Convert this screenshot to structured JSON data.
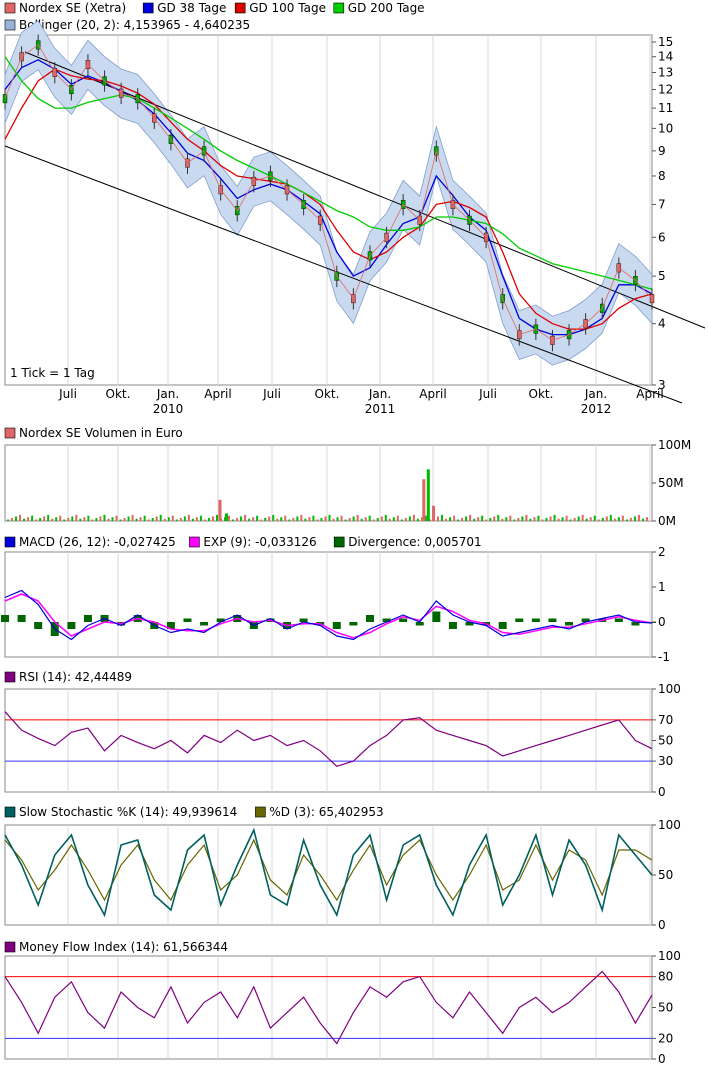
{
  "chart_data": [
    {
      "type": "line",
      "title": "",
      "legend": [
        {
          "label": "Nordex SE (Xetra)",
          "color": "#e06666"
        },
        {
          "label": "GD 38 Tage",
          "color": "#0000dd"
        },
        {
          "label": "GD 100 Tage",
          "color": "#dd0000"
        },
        {
          "label": "GD 200 Tage",
          "color": "#00cc00"
        },
        {
          "label": "Bollinger (20, 2): 4,153965 - 4,640235",
          "color": "#99b3d9"
        }
      ],
      "legend_placement": "top-left",
      "y_scale": "log",
      "ylim": [
        3,
        15.5
      ],
      "yticks": [
        "3",
        "4",
        "5",
        "6",
        "7",
        "8",
        "9",
        "10",
        "11",
        "12",
        "13",
        "14",
        "15"
      ],
      "xticks": [
        {
          "label": "Juli",
          "year": ""
        },
        {
          "label": "Okt.",
          "year": ""
        },
        {
          "label": "Jan.",
          "year": "2010"
        },
        {
          "label": "April",
          "year": ""
        },
        {
          "label": "Juli",
          "year": ""
        },
        {
          "label": "Okt.",
          "year": ""
        },
        {
          "label": "Jan.",
          "year": "2011"
        },
        {
          "label": "April",
          "year": ""
        },
        {
          "label": "Juli",
          "year": ""
        },
        {
          "label": "Okt.",
          "year": ""
        },
        {
          "label": "Jan.",
          "year": "2012"
        },
        {
          "label": "April",
          "year": ""
        }
      ],
      "note": "1 Tick = 1 Tag",
      "grid": true,
      "series": [
        {
          "name": "Nordex SE (Xetra)",
          "color": "#e06666",
          "values": [
            11.5,
            14.0,
            14.8,
            13.0,
            12.0,
            13.5,
            12.5,
            11.8,
            11.5,
            10.5,
            9.5,
            8.5,
            9.0,
            7.5,
            6.8,
            7.8,
            8.0,
            7.5,
            7.0,
            6.5,
            5.0,
            4.5,
            5.5,
            6.0,
            7.0,
            6.5,
            9.0,
            7.0,
            6.5,
            6.0,
            4.5,
            3.8,
            3.9,
            3.7,
            3.8,
            4.0,
            4.3,
            5.2,
            4.9,
            4.5
          ]
        },
        {
          "name": "GD 38 Tage",
          "color": "#0000dd",
          "values": [
            12.0,
            13.3,
            13.8,
            13.2,
            12.3,
            12.8,
            12.4,
            11.9,
            11.4,
            10.7,
            9.8,
            8.9,
            8.6,
            7.9,
            7.2,
            7.5,
            7.7,
            7.5,
            7.1,
            6.7,
            5.6,
            5.0,
            5.2,
            5.8,
            6.4,
            6.6,
            8.0,
            7.3,
            6.6,
            6.2,
            5.0,
            4.1,
            3.9,
            3.8,
            3.8,
            3.9,
            4.1,
            4.8,
            4.8,
            4.6
          ]
        },
        {
          "name": "GD 100 Tage",
          "color": "#dd0000",
          "values": [
            9.5,
            11.0,
            12.5,
            13.2,
            12.8,
            12.6,
            12.5,
            12.2,
            11.8,
            11.2,
            10.3,
            9.5,
            9.0,
            8.4,
            8.0,
            7.9,
            7.8,
            7.7,
            7.4,
            7.0,
            6.2,
            5.6,
            5.4,
            5.6,
            6.0,
            6.3,
            7.0,
            7.1,
            6.9,
            6.6,
            5.6,
            4.6,
            4.2,
            4.0,
            3.9,
            3.9,
            4.0,
            4.3,
            4.5,
            4.6
          ]
        },
        {
          "name": "GD 200 Tage",
          "color": "#00cc00",
          "values": [
            14.0,
            12.5,
            11.5,
            11.0,
            11.0,
            11.3,
            11.5,
            11.7,
            11.5,
            11.0,
            10.5,
            10.0,
            9.5,
            9.0,
            8.6,
            8.3,
            8.0,
            7.7,
            7.4,
            7.1,
            6.8,
            6.6,
            6.3,
            6.2,
            6.2,
            6.3,
            6.6,
            6.6,
            6.5,
            6.4,
            6.1,
            5.7,
            5.5,
            5.3,
            5.2,
            5.1,
            5.0,
            4.9,
            4.8,
            4.7
          ]
        }
      ]
    },
    {
      "type": "bar",
      "title": "",
      "legend": [
        {
          "label": "Nordex SE Volumen in Euro",
          "color": "#e06666"
        }
      ],
      "ylim": [
        0,
        100
      ],
      "yticks": [
        "100M",
        "50M",
        "0M"
      ],
      "spikes": [
        {
          "pos": 0.33,
          "value": 28
        },
        {
          "pos": 0.34,
          "value": 10
        },
        {
          "pos": 0.645,
          "value": 55
        },
        {
          "pos": 0.652,
          "value": 68
        },
        {
          "pos": 0.66,
          "value": 20
        }
      ]
    },
    {
      "type": "line",
      "title": "",
      "legend": [
        {
          "label": "MACD (26, 12): -0,027425",
          "color": "#0000dd"
        },
        {
          "label": "EXP (9): -0,033126",
          "color": "#ff00ff"
        },
        {
          "label": "Divergence: 0,005701",
          "color": "#006600"
        }
      ],
      "ylim": [
        -1,
        2
      ],
      "yticks": [
        "2",
        "1",
        "0",
        "-1"
      ],
      "series": [
        {
          "name": "MACD (26, 12): -0,027425",
          "color": "#0000dd",
          "values": [
            0.7,
            0.9,
            0.5,
            -0.2,
            -0.5,
            -0.1,
            0.1,
            -0.1,
            0.2,
            -0.1,
            -0.3,
            -0.2,
            -0.3,
            0.0,
            0.2,
            -0.1,
            0.1,
            -0.2,
            0.0,
            -0.1,
            -0.4,
            -0.5,
            -0.2,
            0.0,
            0.2,
            0.0,
            0.6,
            0.2,
            0.0,
            -0.1,
            -0.4,
            -0.3,
            -0.2,
            -0.1,
            -0.2,
            0.0,
            0.1,
            0.2,
            0.0,
            -0.03
          ]
        },
        {
          "name": "EXP (9): -0,033126",
          "color": "#ff00ff",
          "values": [
            0.6,
            0.8,
            0.6,
            0.0,
            -0.4,
            -0.2,
            0.0,
            -0.05,
            0.1,
            0.0,
            -0.2,
            -0.25,
            -0.25,
            -0.05,
            0.1,
            0.0,
            0.05,
            -0.1,
            -0.05,
            -0.05,
            -0.3,
            -0.45,
            -0.3,
            -0.05,
            0.15,
            0.05,
            0.45,
            0.3,
            0.05,
            -0.05,
            -0.3,
            -0.35,
            -0.25,
            -0.15,
            -0.15,
            -0.05,
            0.05,
            0.15,
            0.05,
            -0.03
          ]
        }
      ]
    },
    {
      "type": "line",
      "title": "",
      "legend": [
        {
          "label": "RSI (14): 42,44489",
          "color": "#800080"
        }
      ],
      "ylim": [
        0,
        100
      ],
      "yticks": [
        "100",
        "70",
        "50",
        "30",
        "0"
      ],
      "lines": [
        70,
        30
      ],
      "series": [
        {
          "name": "RSI (14): 42,44489",
          "color": "#800080",
          "values": [
            78,
            60,
            52,
            45,
            58,
            62,
            40,
            55,
            48,
            42,
            50,
            38,
            55,
            48,
            60,
            50,
            55,
            45,
            50,
            40,
            25,
            30,
            45,
            55,
            70,
            72,
            60,
            55,
            50,
            45,
            35,
            40,
            45,
            50,
            55,
            60,
            65,
            70,
            50,
            42
          ]
        }
      ]
    },
    {
      "type": "line",
      "title": "",
      "legend": [
        {
          "label": "Slow Stochastic %K (14): 49,939614",
          "color": "#005f5f"
        },
        {
          "label": "%D (3): 65,402953",
          "color": "#666600"
        }
      ],
      "ylim": [
        0,
        100
      ],
      "yticks": [
        "100",
        "50",
        "0"
      ],
      "series": [
        {
          "name": "Slow Stochastic %K (14): 49,939614",
          "color": "#005f5f",
          "values": [
            90,
            60,
            20,
            70,
            90,
            40,
            10,
            80,
            85,
            30,
            15,
            75,
            90,
            20,
            60,
            95,
            30,
            20,
            85,
            40,
            10,
            70,
            90,
            25,
            80,
            90,
            40,
            10,
            60,
            90,
            20,
            50,
            90,
            30,
            85,
            60,
            15,
            90,
            70,
            50
          ]
        },
        {
          "name": "%D (3): 65,402953",
          "color": "#666600",
          "values": [
            85,
            65,
            35,
            55,
            80,
            55,
            25,
            60,
            80,
            45,
            25,
            60,
            80,
            35,
            50,
            85,
            45,
            30,
            70,
            50,
            25,
            55,
            80,
            40,
            70,
            85,
            50,
            25,
            50,
            80,
            35,
            45,
            80,
            45,
            75,
            65,
            30,
            75,
            75,
            65
          ]
        }
      ]
    },
    {
      "type": "line",
      "title": "",
      "legend": [
        {
          "label": "Money Flow Index (14): 61,566344",
          "color": "#800080"
        }
      ],
      "ylim": [
        0,
        100
      ],
      "yticks": [
        "100",
        "80",
        "50",
        "20",
        "0"
      ],
      "lines": [
        80,
        20
      ],
      "series": [
        {
          "name": "Money Flow Index (14): 61,566344",
          "color": "#800080",
          "values": [
            80,
            55,
            25,
            60,
            75,
            45,
            30,
            65,
            50,
            40,
            70,
            35,
            55,
            65,
            40,
            70,
            30,
            45,
            60,
            35,
            15,
            45,
            70,
            60,
            75,
            80,
            55,
            40,
            65,
            45,
            25,
            50,
            60,
            45,
            55,
            70,
            85,
            65,
            35,
            62
          ]
        }
      ]
    }
  ]
}
